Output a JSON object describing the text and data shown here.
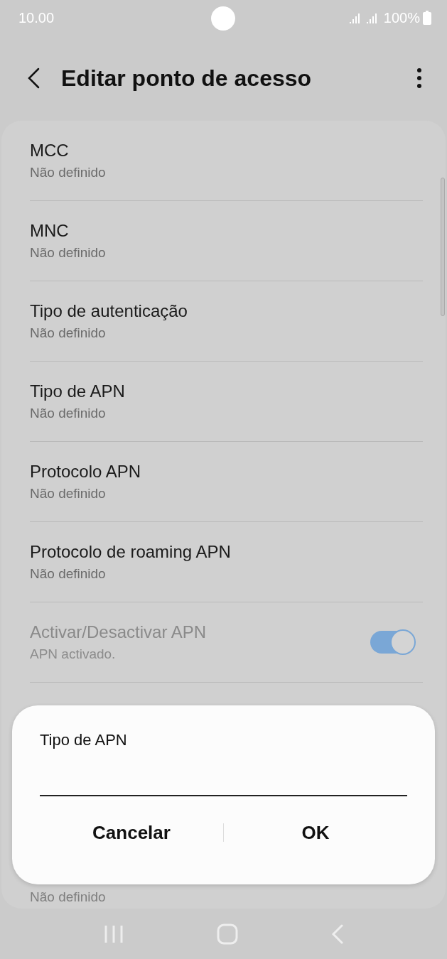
{
  "status_bar": {
    "time": "10.00",
    "battery": "100%"
  },
  "header": {
    "title": "Editar ponto de acesso"
  },
  "settings": [
    {
      "kind": "text",
      "title": "MCC",
      "subtitle": "Não definido",
      "disabled": false
    },
    {
      "kind": "text",
      "title": "MNC",
      "subtitle": "Não definido",
      "disabled": false
    },
    {
      "kind": "text",
      "title": "Tipo de autenticação",
      "subtitle": "Não definido",
      "disabled": false
    },
    {
      "kind": "text",
      "title": "Tipo de APN",
      "subtitle": "Não definido",
      "disabled": false
    },
    {
      "kind": "text",
      "title": "Protocolo APN",
      "subtitle": "Não definido",
      "disabled": false
    },
    {
      "kind": "text",
      "title": "Protocolo de roaming APN",
      "subtitle": "Não definido",
      "disabled": false
    },
    {
      "kind": "switch",
      "title": "Activar/Desactivar APN",
      "subtitle": "APN activado.",
      "disabled": true,
      "on": true
    }
  ],
  "partial_row": {
    "subtitle": "Não definido"
  },
  "dialog": {
    "title": "Tipo de APN",
    "buttons": [
      "Cancelar",
      "OK"
    ]
  }
}
